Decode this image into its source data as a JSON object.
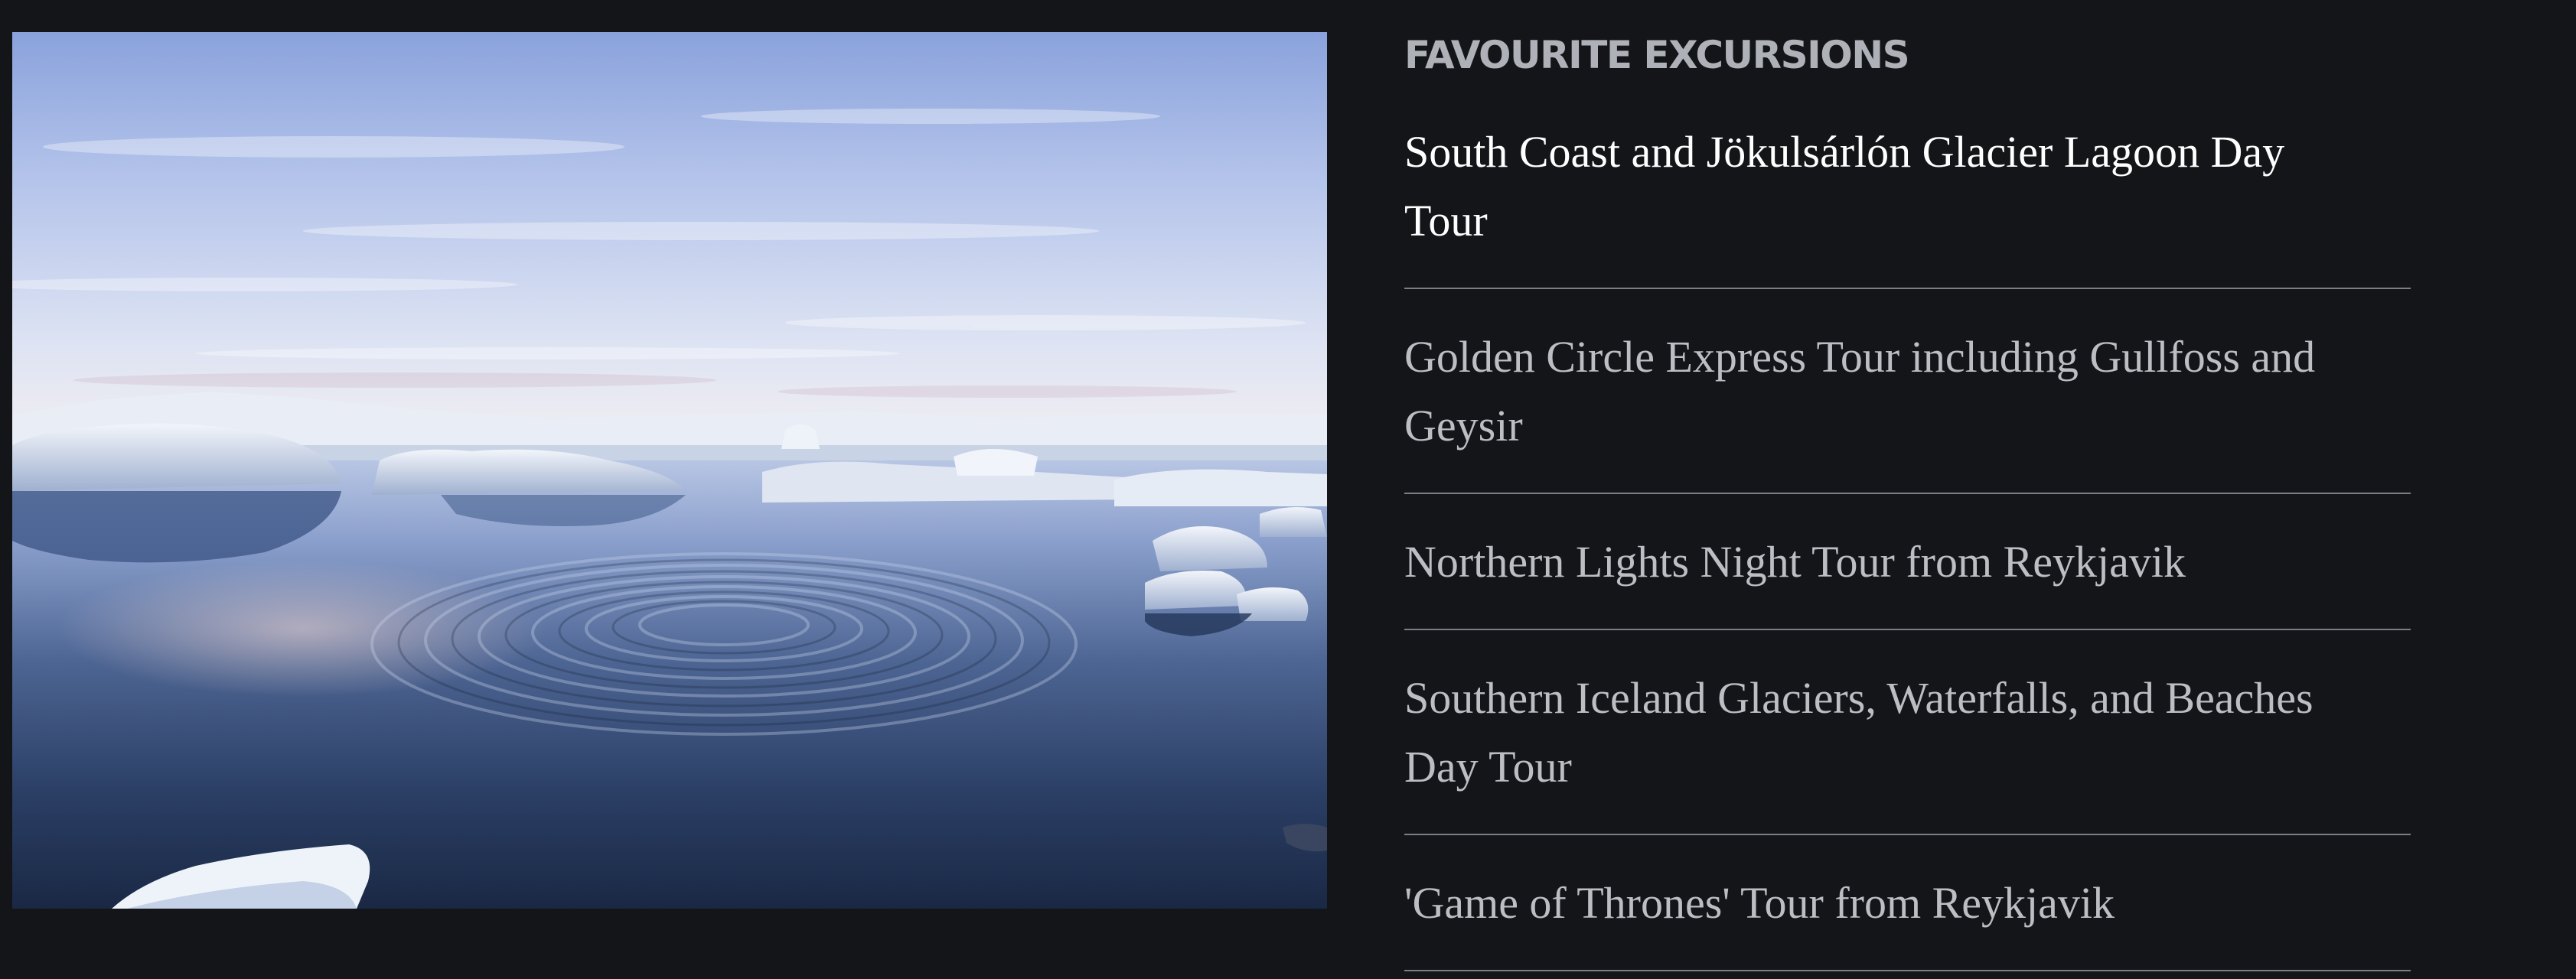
{
  "photo": {
    "alt": "Glacier lagoon with floating icebergs and ripples in the water",
    "colors": {
      "sky_top": "#8fa6dc",
      "sky_horizon": "#eef0f8",
      "water_top": "#a6b7dc",
      "water_deep": "#1d2d4c",
      "ice": "#e9eef6"
    }
  },
  "sidebar": {
    "heading": "FAVOURITE EXCURSIONS",
    "excursions": [
      {
        "label": "South Coast and Jökulsárlón Glacier Lagoon Day Tour",
        "active": true
      },
      {
        "label": "Golden Circle Express Tour including Gullfoss and Geysir",
        "active": false
      },
      {
        "label": "Northern Lights Night Tour from Reykjavik",
        "active": false
      },
      {
        "label": "Southern Iceland Glaciers, Waterfalls, and Beaches Day Tour",
        "active": false
      },
      {
        "label": "'Game of Thrones' Tour from Reykjavik",
        "active": false
      }
    ]
  },
  "colors": {
    "page_background": "#141519",
    "heading_text": "#aeb1b7",
    "active_link": "#ffffff",
    "inactive_link": "#bcbec3",
    "divider": "#7b7e85"
  }
}
